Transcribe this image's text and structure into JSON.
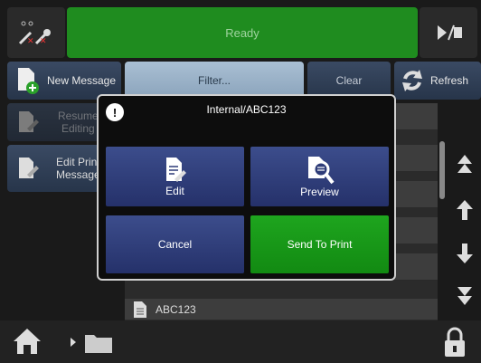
{
  "status": {
    "text": "Ready"
  },
  "toolbar": {
    "new_message": "New Message",
    "filter_placeholder": "Filter...",
    "clear": "Clear",
    "refresh": "Refresh"
  },
  "sidebar": {
    "resume_editing_line1": "Resume",
    "resume_editing_line2": "Editing",
    "edit_print_line1": "Edit Print",
    "edit_print_line2": "Message"
  },
  "list": {
    "items": [
      "ABC123"
    ]
  },
  "modal": {
    "title": "Internal/ABC123",
    "info_icon": "!",
    "edit": "Edit",
    "preview": "Preview",
    "cancel": "Cancel",
    "send_to_print": "Send To Print"
  },
  "colors": {
    "status_green": "#1f8c1f",
    "send_green": "#1ea51e",
    "dialog_blue": "#2e3c78"
  }
}
